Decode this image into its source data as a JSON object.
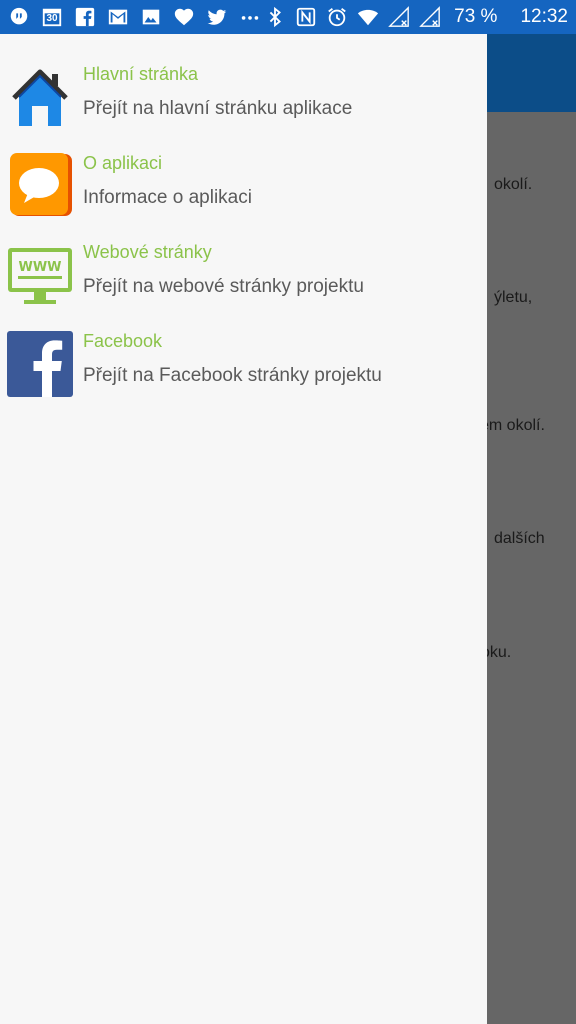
{
  "status_bar": {
    "left_icons": [
      "quote-bubble-icon",
      "calendar-icon",
      "facebook-icon",
      "gmail-icon",
      "image-icon",
      "heart-icon",
      "twitter-icon",
      "more-dots-icon"
    ],
    "calendar_day": "30",
    "right_icons": [
      "bluetooth-icon",
      "nfc-icon",
      "alarm-icon",
      "wifi-icon",
      "sim1-no-signal-icon",
      "sim2-no-signal-icon"
    ],
    "battery": "73 %",
    "time": "12:32"
  },
  "background_app": {
    "visible_text_fragments": [
      "okolí.",
      "ýletu,",
      "em okolí.",
      "dalších",
      "oku."
    ]
  },
  "drawer": {
    "items": [
      {
        "icon": "home-icon",
        "title": "Hlavní stránka",
        "subtitle": "Přejít na hlavní stránku aplikace"
      },
      {
        "icon": "speech-bubble-icon",
        "title": "O aplikaci",
        "subtitle": "Informace o aplikaci"
      },
      {
        "icon": "www-monitor-icon",
        "title": "Webové stránky",
        "subtitle": "Přejít na webové stránky projektu"
      },
      {
        "icon": "facebook-icon",
        "title": "Facebook",
        "subtitle": "Přejít na Facebook stránky projektu"
      }
    ]
  },
  "colors": {
    "status_bar": "#1565c0",
    "app_bar": "#0c4d88",
    "scrim_background": "#666666",
    "drawer_background": "#f7f7f7",
    "title_green": "#8bc34a",
    "subtitle_gray": "#5a5a5a"
  }
}
